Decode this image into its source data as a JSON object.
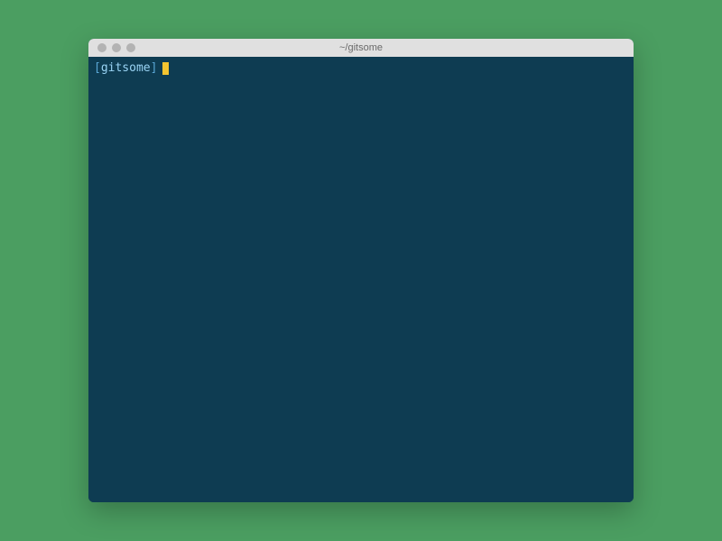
{
  "window": {
    "title": "~/gitsome"
  },
  "terminal": {
    "prompt_open": "[",
    "prompt_name": "gitsome",
    "prompt_close": "]",
    "input_value": ""
  }
}
